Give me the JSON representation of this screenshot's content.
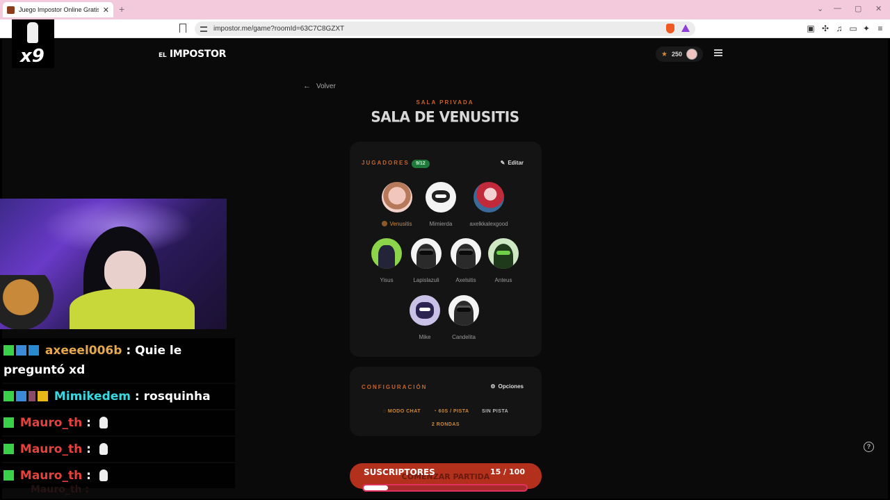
{
  "browser": {
    "tab_title": "Juego Impostor Online Gratis - J",
    "tab_close": "✕",
    "new_tab": "+",
    "url": "impostor.me/game?roomId=63C7C8GZXT",
    "window_controls": [
      "⌄",
      "—",
      "▢",
      "✕"
    ]
  },
  "header": {
    "logo_prefix": "EL",
    "logo_main": " IMPOSTOR",
    "coins": "250"
  },
  "back_label": "Volver",
  "room": {
    "kicker": "SALA PRIVADA",
    "title": "SALA DE VENUSITIS"
  },
  "players_card": {
    "label": "JUGADORES",
    "badge": "9/12",
    "action": "Editar",
    "players": [
      {
        "name": "Venusitis",
        "avatar": "girl",
        "host": true
      },
      {
        "name": "Mimierda",
        "avatar": "panda"
      },
      {
        "name": "axelkkalexgood",
        "avatar": "anime"
      },
      {
        "name": "Yisus",
        "avatar": "green"
      },
      {
        "name": "Lapislazuli",
        "avatar": "mask"
      },
      {
        "name": "Axelsitis",
        "avatar": "mask"
      },
      {
        "name": "Anteus",
        "avatar": "mask-green"
      },
      {
        "name": "Mike",
        "avatar": "panda-purple"
      },
      {
        "name": "Candelita",
        "avatar": "mask"
      }
    ]
  },
  "config_card": {
    "label": "CONFIGURACIÓN",
    "action": "Opciones",
    "tags": [
      "MODO CHAT",
      "60S / PISTA",
      "SIN PISTA",
      "2 RONDAS"
    ]
  },
  "start_button": "COMENZAR PARTIDA",
  "subs_goal": {
    "label": "SUSCRIPTORES",
    "current": "15",
    "sep": " / ",
    "target": "100",
    "progress": 0.15
  },
  "help": "?",
  "overlay": {
    "multiplier": "x9"
  },
  "chat": [
    {
      "user": "axeeel006b",
      "text": " : Quie le preguntó xd"
    },
    {
      "user": "Mimikedem",
      "text": " : rosquinha"
    },
    {
      "user": "Mauro_th",
      "text": " : "
    },
    {
      "user": "Mauro_th",
      "text": " : "
    },
    {
      "user": "Mauro_th",
      "text": " : "
    }
  ],
  "chat_faded": "Mauro_th :"
}
